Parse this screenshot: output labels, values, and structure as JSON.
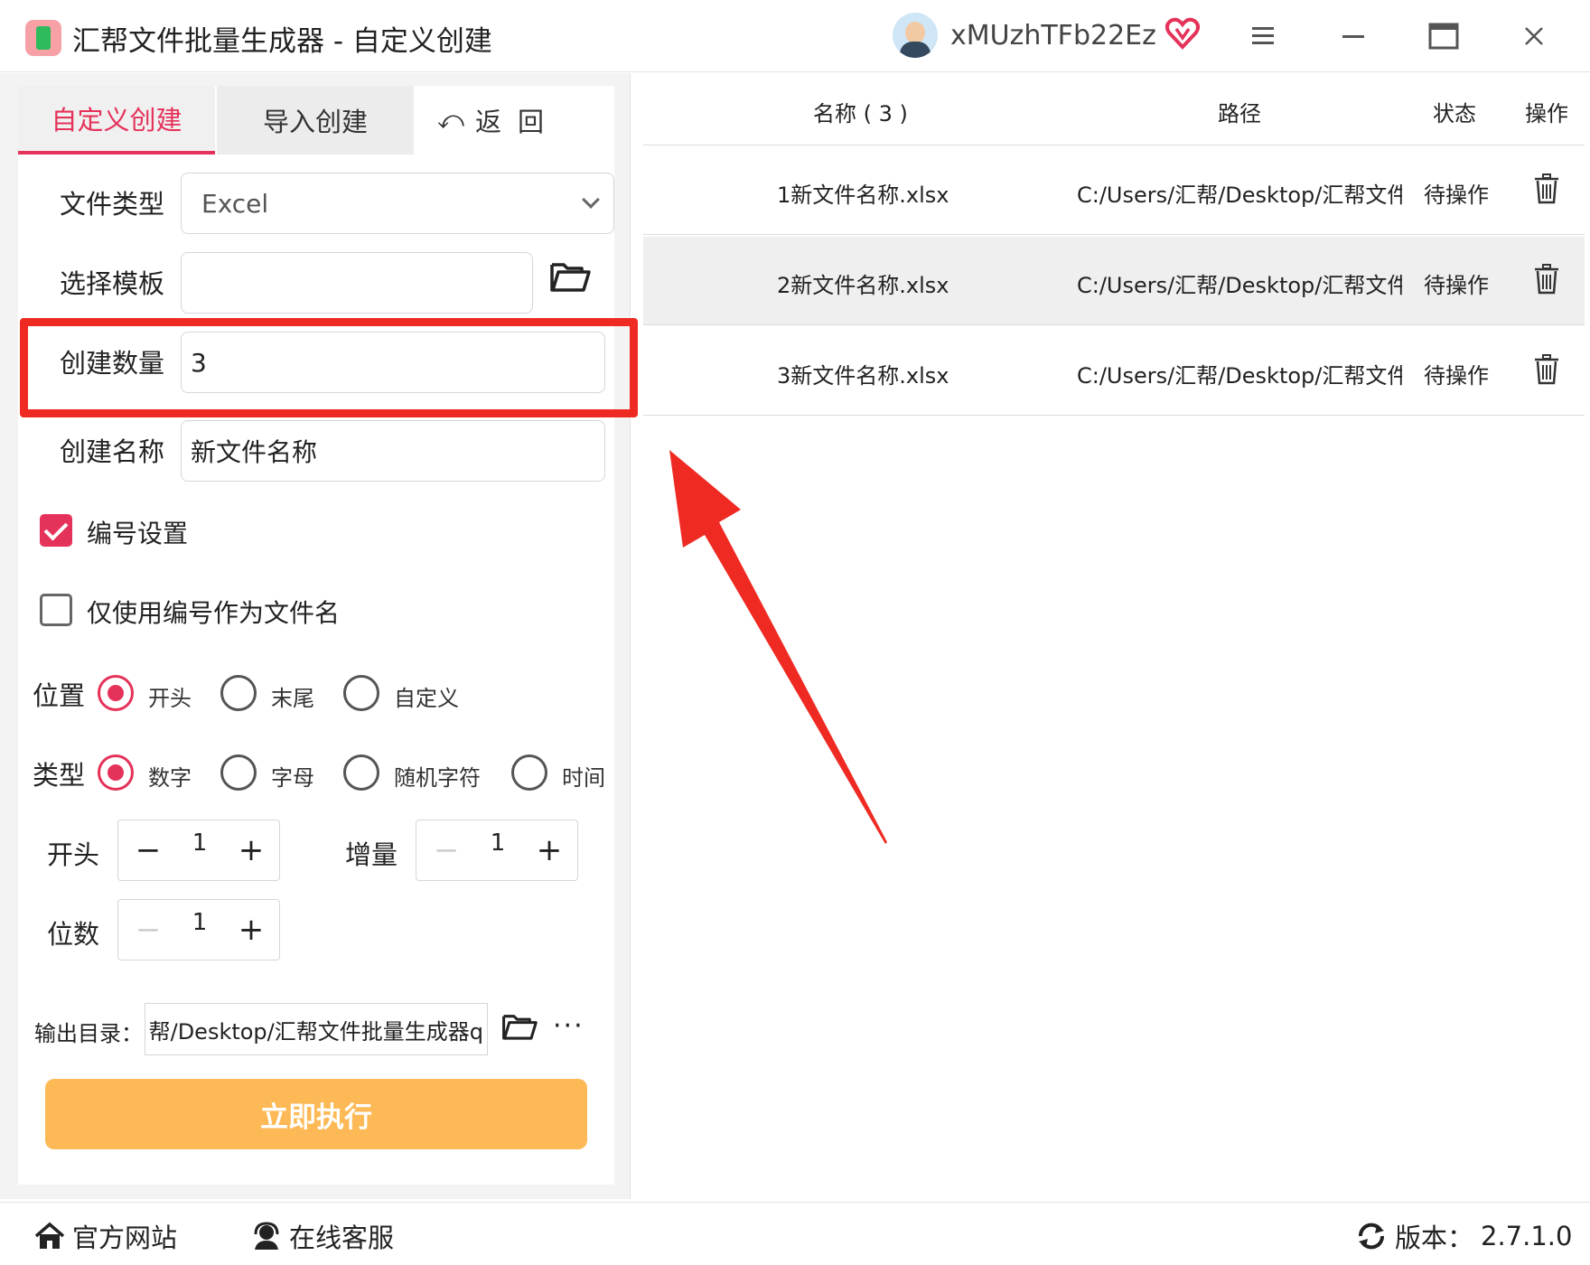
{
  "window": {
    "title": "汇帮文件批量生成器 - 自定义创建",
    "username": "xMUzhTFb22Ez",
    "icons": {
      "app": "app-icon",
      "avatar": "avatar",
      "vip": "vip-heart-icon",
      "menu": "menu-icon",
      "minimize": "minimize-icon",
      "maximize": "maximize-icon",
      "close": "close-icon"
    }
  },
  "tabs": {
    "custom": "自定义创建",
    "import": "导入创建",
    "back_icon": "⤺",
    "back": "返回"
  },
  "form": {
    "file_type_label": "文件类型",
    "file_type_value": "Excel",
    "template_label": "选择模板",
    "template_value": "",
    "count_label": "创建数量",
    "count_value": "3",
    "name_label": "创建名称",
    "name_value": "新文件名称"
  },
  "numbering": {
    "enabled_label": "编号设置",
    "enabled": true,
    "only_number_label": "仅使用编号作为文件名",
    "only_number": false,
    "position_label": "位置",
    "position_options": [
      "开头",
      "末尾",
      "自定义"
    ],
    "position_selected": "开头",
    "type_label": "类型",
    "type_options": [
      "数字",
      "字母",
      "随机字符",
      "时间"
    ],
    "type_selected": "数字",
    "start_label": "开头",
    "start_value": "1",
    "increment_label": "增量",
    "increment_value": "1",
    "digits_label": "位数",
    "digits_value": "1"
  },
  "output": {
    "label": "输出目录：",
    "path": "帮/Desktop/汇帮文件批量生成器q",
    "more": "···"
  },
  "run_button": "立即执行",
  "table": {
    "headers": {
      "name": "名称 ( 3 )",
      "path": "路径",
      "status": "状态",
      "action": "操作"
    },
    "rows": [
      {
        "name": "1新文件名称.xlsx",
        "path": "C:/Users/汇帮/Desktop/汇帮文件",
        "status": "待操作"
      },
      {
        "name": "2新文件名称.xlsx",
        "path": "C:/Users/汇帮/Desktop/汇帮文件",
        "status": "待操作"
      },
      {
        "name": "3新文件名称.xlsx",
        "path": "C:/Users/汇帮/Desktop/汇帮文件",
        "status": "待操作"
      }
    ]
  },
  "footer": {
    "website": "官方网站",
    "support": "在线客服",
    "version_label": "版本：",
    "version": "2.7.1.0"
  },
  "colors": {
    "accent": "#e5325a",
    "highlight": "#ef2a23",
    "run_button": "#fdb955",
    "arrow": "#ef2a23"
  }
}
